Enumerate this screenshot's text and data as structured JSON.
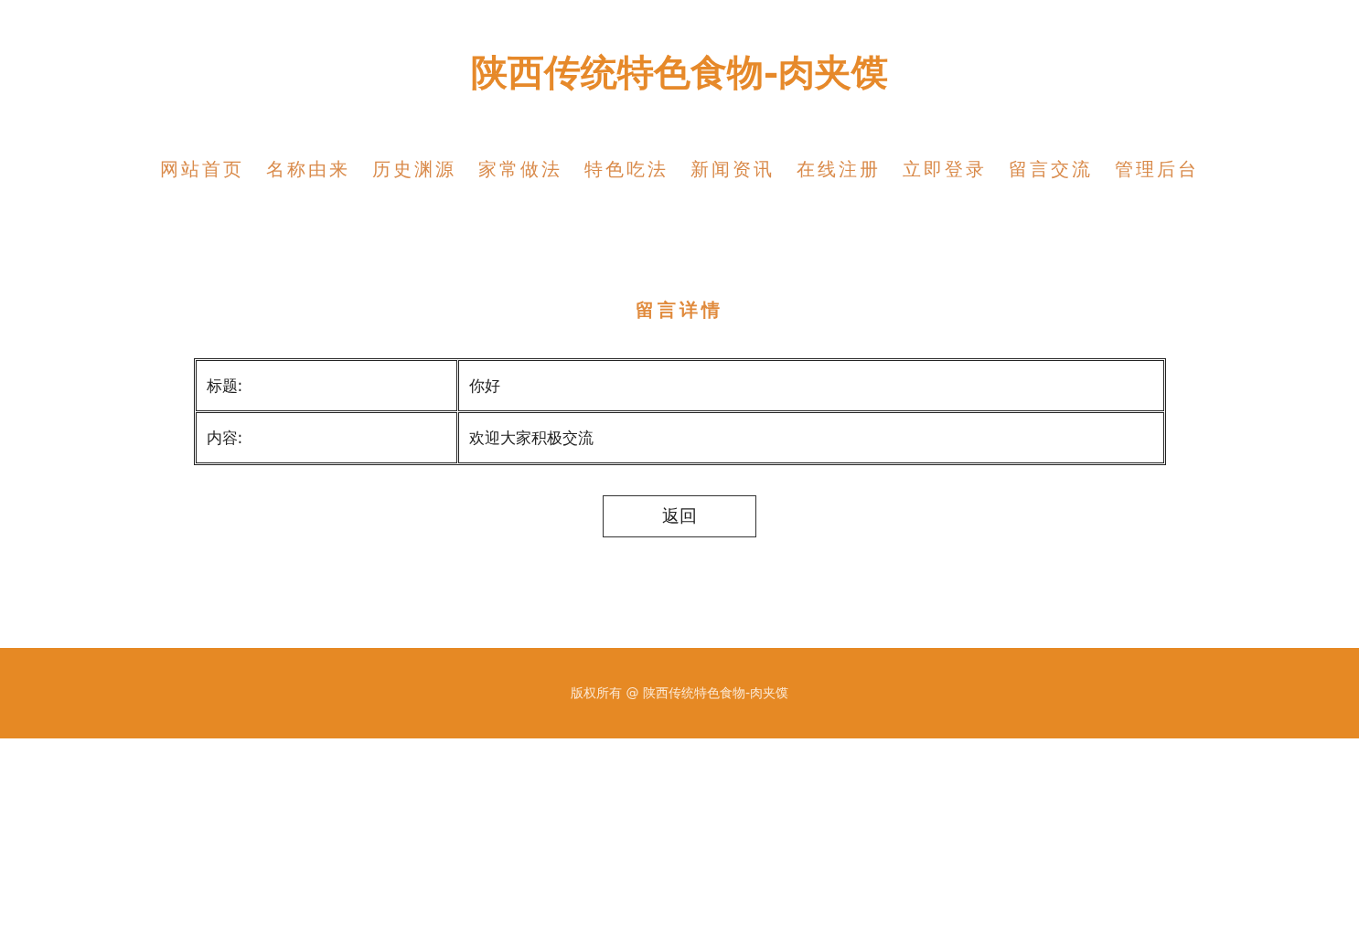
{
  "site_title": "陕西传统特色食物-肉夹馍",
  "nav": [
    "网站首页",
    "名称由来",
    "历史渊源",
    "家常做法",
    "特色吃法",
    "新闻资讯",
    "在线注册",
    "立即登录",
    "留言交流",
    "管理后台"
  ],
  "heading": "留言详情",
  "table": {
    "rows": [
      {
        "label": "标题:",
        "value": "你好"
      },
      {
        "label": "内容:",
        "value": "欢迎大家积极交流"
      }
    ]
  },
  "back_button": "返回",
  "footer": "版权所有 @ 陕西传统特色食物-肉夹馍"
}
